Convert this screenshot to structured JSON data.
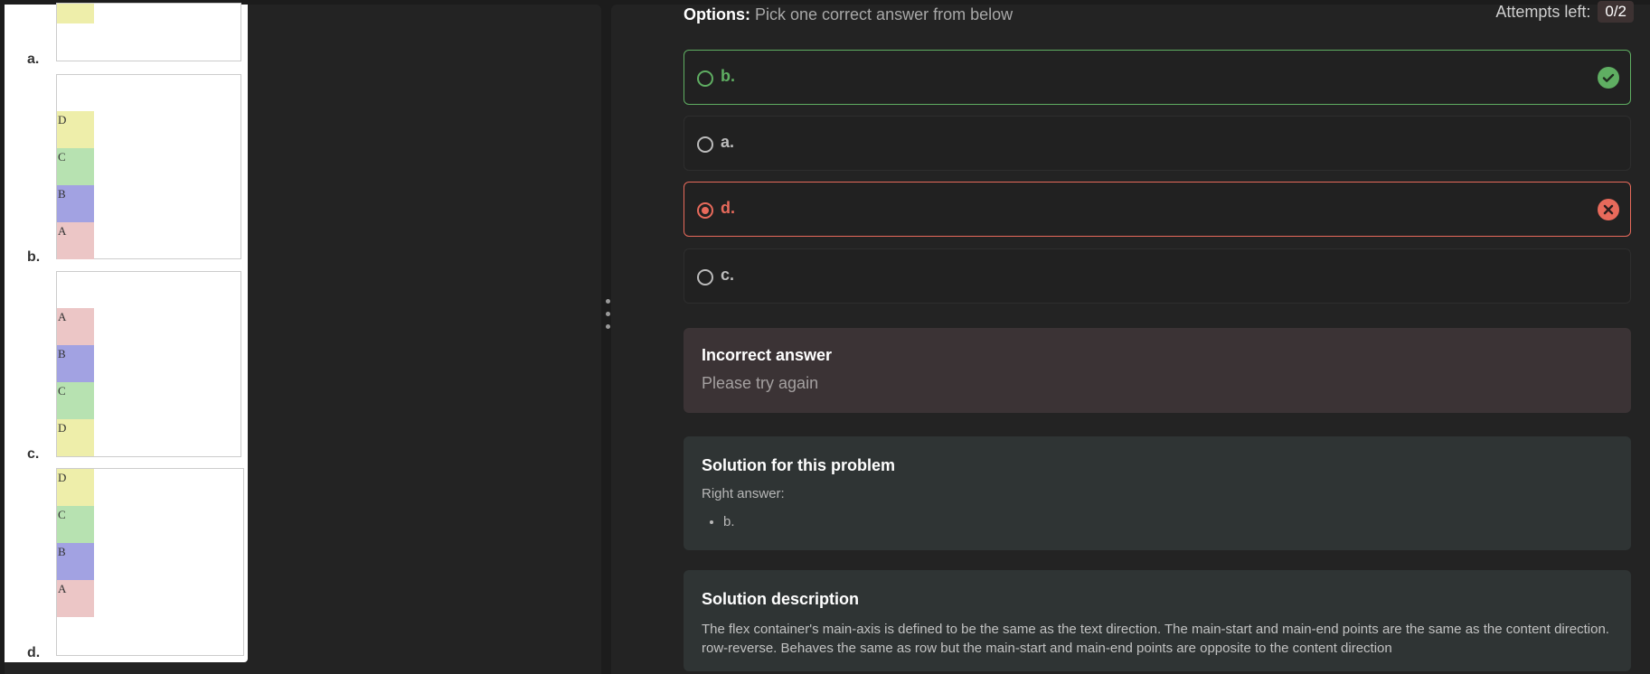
{
  "left_images": {
    "options": [
      {
        "label": "a.",
        "blocks": []
      },
      {
        "label": "b.",
        "blocks": [
          "D",
          "C",
          "B",
          "A"
        ]
      },
      {
        "label": "c.",
        "blocks": [
          "A",
          "B",
          "C",
          "D"
        ]
      },
      {
        "label": "d.",
        "blocks": [
          "D",
          "C",
          "B",
          "A"
        ]
      }
    ]
  },
  "options_section": {
    "heading_bold": "Options:",
    "heading_text": " Pick one correct answer from below",
    "attempts_label": "Attempts left:",
    "attempts_value": "0/2",
    "choices": [
      {
        "label": "b.",
        "state": "correct"
      },
      {
        "label": "a.",
        "state": "none"
      },
      {
        "label": "d.",
        "state": "wrong-selected"
      },
      {
        "label": "c.",
        "state": "none"
      }
    ]
  },
  "feedback": {
    "title": "Incorrect answer",
    "message": "Please try again"
  },
  "solution": {
    "title": "Solution for this problem",
    "subtitle": "Right answer:",
    "answers": [
      "b."
    ]
  },
  "description": {
    "title": "Solution description",
    "text": "The flex container's main-axis is defined to be the same as the text direction. The main-start and main-end points are the same as the content direction. row-reverse. Behaves the same as row but the main-start and main-end points are opposite to the content direction"
  },
  "colors": {
    "correct": "#5fae62",
    "wrong": "#e86a5b",
    "block_yellow": "#eeeeaa",
    "block_green": "#b7e2b1",
    "block_blue": "#a2a2e2",
    "block_pink": "#ecc6c6"
  }
}
